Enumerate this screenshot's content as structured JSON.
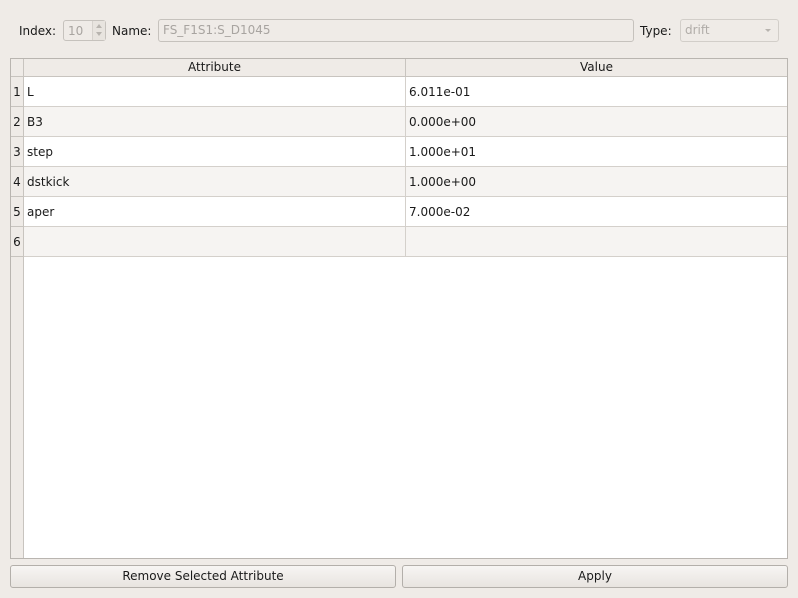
{
  "form": {
    "index_label": "Index:",
    "index_value": "10",
    "name_label": "Name:",
    "name_value": "FS_F1S1:S_D1045",
    "type_label": "Type:",
    "type_value": "drift"
  },
  "table": {
    "headers": [
      "Attribute",
      "Value"
    ],
    "rows": [
      {
        "num": "1",
        "attribute": "L",
        "value": "6.011e-01"
      },
      {
        "num": "2",
        "attribute": "B3",
        "value": "0.000e+00"
      },
      {
        "num": "3",
        "attribute": "step",
        "value": "1.000e+01"
      },
      {
        "num": "4",
        "attribute": "dstkick",
        "value": "1.000e+00"
      },
      {
        "num": "5",
        "attribute": "aper",
        "value": "7.000e-02"
      },
      {
        "num": "6",
        "attribute": "",
        "value": ""
      }
    ]
  },
  "buttons": {
    "remove_label": "Remove Selected Attribute",
    "apply_label": "Apply"
  }
}
